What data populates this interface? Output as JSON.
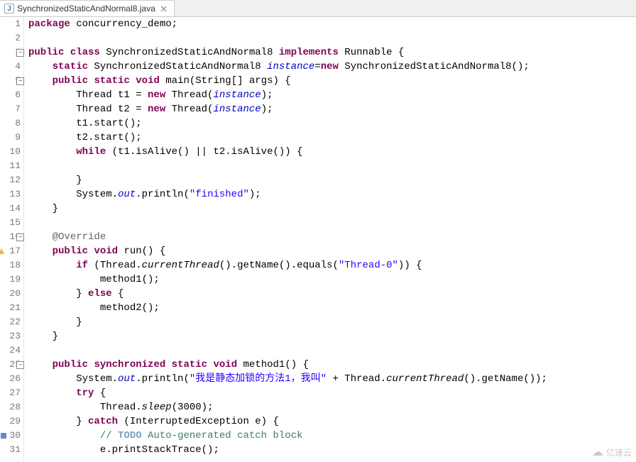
{
  "tab": {
    "filename": "SynchronizedStaticAndNormal8.java"
  },
  "watermark": "亿速云",
  "lines": [
    {
      "n": 1,
      "fold": false,
      "warn": false,
      "todo": false,
      "html": "<span class='kw'>package</span> concurrency_demo;"
    },
    {
      "n": 2,
      "fold": false,
      "warn": false,
      "todo": false,
      "html": ""
    },
    {
      "n": 3,
      "fold": true,
      "warn": false,
      "todo": false,
      "html": "<span class='kw'>public</span> <span class='kw'>class</span> SynchronizedStaticAndNormal8 <span class='kw'>implements</span> Runnable {"
    },
    {
      "n": 4,
      "fold": false,
      "warn": false,
      "todo": false,
      "html": "    <span class='kw'>static</span> SynchronizedStaticAndNormal8 <span class='fld'>instance</span>=<span class='kw'>new</span> SynchronizedStaticAndNormal8();"
    },
    {
      "n": 5,
      "fold": true,
      "warn": false,
      "todo": false,
      "html": "    <span class='kw'>public</span> <span class='kw'>static</span> <span class='kw'>void</span> main(String[] args) {"
    },
    {
      "n": 6,
      "fold": false,
      "warn": false,
      "todo": false,
      "html": "        Thread t1 = <span class='kw'>new</span> Thread(<span class='fld'>instance</span>);"
    },
    {
      "n": 7,
      "fold": false,
      "warn": false,
      "todo": false,
      "html": "        Thread t2 = <span class='kw'>new</span> Thread(<span class='fld'>instance</span>);"
    },
    {
      "n": 8,
      "fold": false,
      "warn": false,
      "todo": false,
      "html": "        t1.start();"
    },
    {
      "n": 9,
      "fold": false,
      "warn": false,
      "todo": false,
      "html": "        t2.start();"
    },
    {
      "n": 10,
      "fold": false,
      "warn": false,
      "todo": false,
      "html": "        <span class='kw'>while</span> (t1.isAlive() || t2.isAlive()) {"
    },
    {
      "n": 11,
      "fold": false,
      "warn": false,
      "todo": false,
      "html": ""
    },
    {
      "n": 12,
      "fold": false,
      "warn": false,
      "todo": false,
      "html": "        }"
    },
    {
      "n": 13,
      "fold": false,
      "warn": false,
      "todo": false,
      "html": "        System.<span class='fld'>out</span>.println(<span class='str'>\"finished\"</span>);"
    },
    {
      "n": 14,
      "fold": false,
      "warn": false,
      "todo": false,
      "html": "    }"
    },
    {
      "n": 15,
      "fold": false,
      "warn": false,
      "todo": false,
      "html": ""
    },
    {
      "n": 16,
      "fold": true,
      "warn": false,
      "todo": false,
      "html": "    <span class='ann'>@Override</span>"
    },
    {
      "n": 17,
      "fold": false,
      "warn": true,
      "todo": false,
      "html": "    <span class='kw'>public</span> <span class='kw'>void</span> run() {"
    },
    {
      "n": 18,
      "fold": false,
      "warn": false,
      "todo": false,
      "html": "        <span class='kw'>if</span> (Thread.<span class='stat'>currentThread</span>().getName().equals(<span class='str'>\"Thread-0\"</span>)) {"
    },
    {
      "n": 19,
      "fold": false,
      "warn": false,
      "todo": false,
      "html": "            method1();"
    },
    {
      "n": 20,
      "fold": false,
      "warn": false,
      "todo": false,
      "html": "        } <span class='kw'>else</span> {"
    },
    {
      "n": 21,
      "fold": false,
      "warn": false,
      "todo": false,
      "html": "            method2();"
    },
    {
      "n": 22,
      "fold": false,
      "warn": false,
      "todo": false,
      "html": "        }"
    },
    {
      "n": 23,
      "fold": false,
      "warn": false,
      "todo": false,
      "html": "    }"
    },
    {
      "n": 24,
      "fold": false,
      "warn": false,
      "todo": false,
      "html": ""
    },
    {
      "n": 25,
      "fold": true,
      "warn": false,
      "todo": false,
      "html": "    <span class='kw'>public</span> <span class='kw'>synchronized</span> <span class='kw'>static</span> <span class='kw'>void</span> method1() {"
    },
    {
      "n": 26,
      "fold": false,
      "warn": false,
      "todo": false,
      "html": "        System.<span class='fld'>out</span>.println(<span class='str'>\"我是静态加锁的方法1，我叫\"</span> + Thread.<span class='stat'>currentThread</span>().getName());"
    },
    {
      "n": 27,
      "fold": false,
      "warn": false,
      "todo": false,
      "html": "        <span class='kw'>try</span> {"
    },
    {
      "n": 28,
      "fold": false,
      "warn": false,
      "todo": false,
      "html": "            Thread.<span class='stat'>sleep</span>(3000);"
    },
    {
      "n": 29,
      "fold": false,
      "warn": false,
      "todo": false,
      "html": "        } <span class='kw'>catch</span> (InterruptedException e) {"
    },
    {
      "n": 30,
      "fold": false,
      "warn": false,
      "todo": true,
      "html": "            <span class='cmt'>// <span class='todo-c'>TODO</span> Auto-generated catch block</span>"
    },
    {
      "n": 31,
      "fold": false,
      "warn": false,
      "todo": false,
      "html": "            e.printStackTrace();"
    }
  ]
}
